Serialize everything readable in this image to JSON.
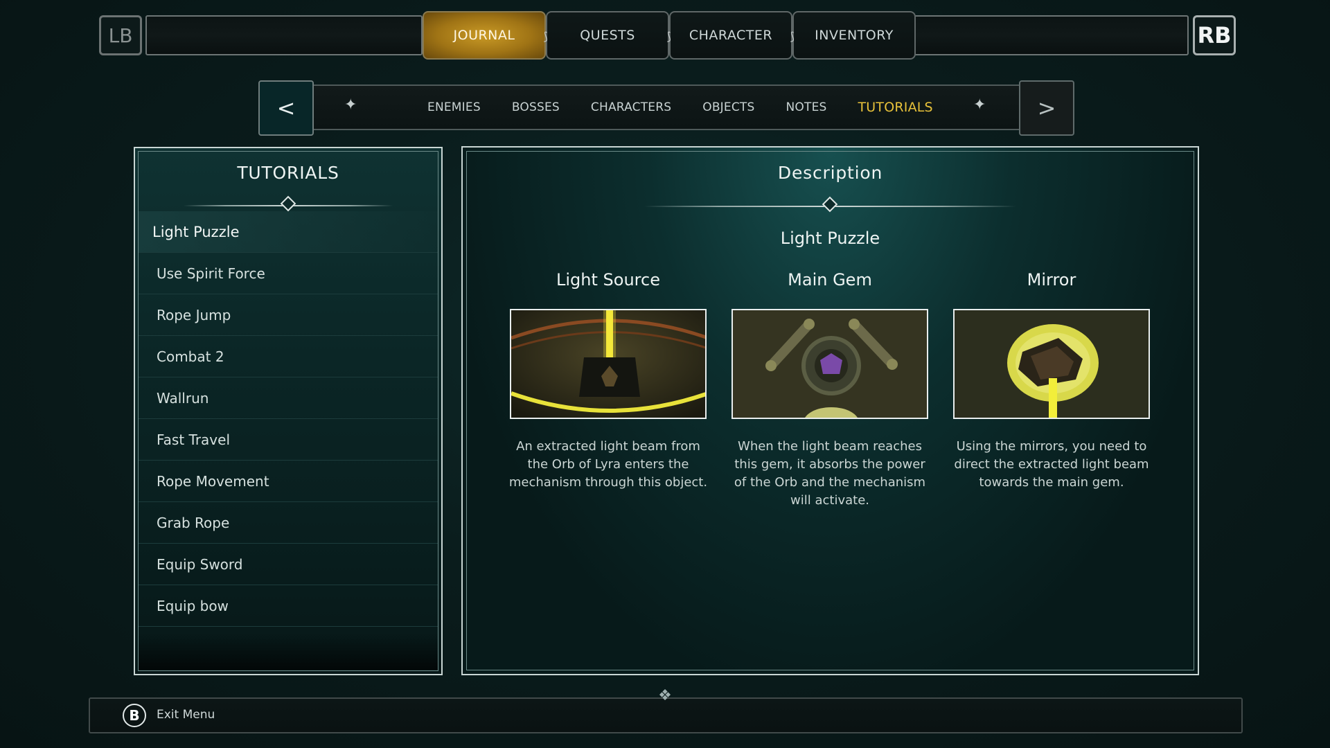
{
  "top_nav": {
    "lb_label": "LB",
    "rb_label": "RB",
    "tabs": [
      {
        "label": "JOURNAL",
        "active": true
      },
      {
        "label": "QUESTS",
        "active": false
      },
      {
        "label": "CHARACTER",
        "active": false
      },
      {
        "label": "INVENTORY",
        "active": false
      }
    ]
  },
  "sub_nav": {
    "prev_label": "<",
    "next_label": ">",
    "items": [
      {
        "label": "ENEMIES",
        "active": false
      },
      {
        "label": "BOSSES",
        "active": false
      },
      {
        "label": "CHARACTERS",
        "active": false
      },
      {
        "label": "OBJECTS",
        "active": false
      },
      {
        "label": "NOTES",
        "active": false
      },
      {
        "label": "TUTORIALS",
        "active": true
      }
    ]
  },
  "list_panel": {
    "title": "TUTORIALS",
    "items": [
      {
        "label": "Light Puzzle",
        "selected": true
      },
      {
        "label": "Use Spirit Force",
        "selected": false
      },
      {
        "label": "Rope Jump",
        "selected": false
      },
      {
        "label": "Combat 2",
        "selected": false
      },
      {
        "label": "Wallrun",
        "selected": false
      },
      {
        "label": "Fast Travel",
        "selected": false
      },
      {
        "label": "Rope Movement",
        "selected": false
      },
      {
        "label": "Grab Rope",
        "selected": false
      },
      {
        "label": "Equip Sword",
        "selected": false
      },
      {
        "label": "Equip bow",
        "selected": false
      }
    ]
  },
  "description_panel": {
    "title": "Description",
    "subtitle": "Light Puzzle",
    "cards": [
      {
        "title": "Light Source",
        "text": "An extracted light beam from the Orb of Lyra enters the mechanism through this object.",
        "image_icon": "light-source-image"
      },
      {
        "title": "Main Gem",
        "text": "When the light beam reaches this gem, it absorbs the power of the Orb and the mechanism will activate.",
        "image_icon": "main-gem-image"
      },
      {
        "title": "Mirror",
        "text": "Using the mirrors, you need to direct the extracted light beam towards the main gem.",
        "image_icon": "mirror-image"
      }
    ]
  },
  "footer": {
    "button_glyph": "B",
    "exit_label": "Exit Menu"
  },
  "colors": {
    "accent_gold": "#e8c23a",
    "active_tab": "#b88a1d",
    "panel_border": "#c9d6d4"
  }
}
